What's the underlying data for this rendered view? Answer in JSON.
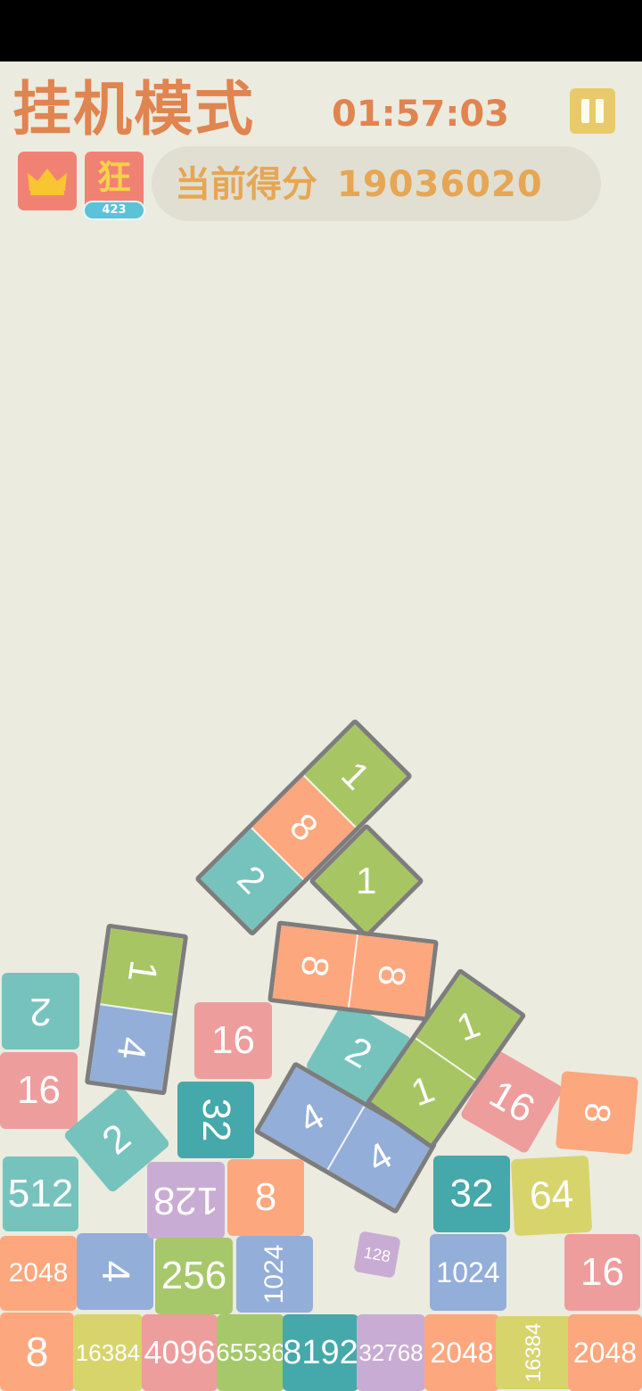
{
  "header": {
    "title": "挂机模式",
    "timer": "01:57:03",
    "frenzy_label": "狂",
    "frenzy_count": "423",
    "score_label": "当前得分",
    "score_value": "19036020"
  },
  "colors": {
    "title": "#e08450",
    "score_text": "#e6a653",
    "tile_2": "#76c3bd",
    "tile_4": "#93aed8",
    "tile_8": "#fda77e",
    "tile_16": "#ee9d9d",
    "tile_32": "#45a8aa",
    "tile_64": "#d7d46c",
    "tile_128": "#c9acd4",
    "tile_256": "#a6c86a",
    "tile_1": "#a8c563"
  },
  "tiles": [
    {
      "label": "2",
      "color": "#76c3bd"
    },
    {
      "label": "16",
      "color": "#ee9d9d"
    },
    {
      "label": "512",
      "color": "#76c3bd"
    },
    {
      "label": "2048",
      "color": "#fda77e"
    },
    {
      "label": "8",
      "color": "#fda77e"
    },
    {
      "label": "2",
      "color": "#76c3bd"
    },
    {
      "label": "4",
      "color": "#93aed8"
    },
    {
      "label": "16384",
      "color": "#d7d46c"
    },
    {
      "label": "128",
      "color": "#c9acd4"
    },
    {
      "label": "256",
      "color": "#a6c86a"
    },
    {
      "label": "4096",
      "color": "#ee9d9d"
    },
    {
      "label": "16",
      "color": "#ee9d9d"
    },
    {
      "label": "32",
      "color": "#45a8aa"
    },
    {
      "label": "8",
      "color": "#fda77e"
    },
    {
      "label": "1024",
      "color": "#93aed8"
    },
    {
      "label": "65536",
      "color": "#a6c86a"
    },
    {
      "label": "8192",
      "color": "#45a8aa"
    },
    {
      "label": "128",
      "color": "#c9acd4"
    },
    {
      "label": "32768",
      "color": "#c9acd4"
    },
    {
      "label": "32",
      "color": "#45a8aa"
    },
    {
      "label": "1024",
      "color": "#93aed8"
    },
    {
      "label": "2048",
      "color": "#fda77e"
    },
    {
      "label": "64",
      "color": "#d7d46c"
    },
    {
      "label": "16384",
      "color": "#d7d46c"
    },
    {
      "label": "16",
      "color": "#ee9d9d"
    },
    {
      "label": "8",
      "color": "#fda77e"
    },
    {
      "label": "16",
      "color": "#ee9d9d"
    },
    {
      "label": "2048",
      "color": "#fda77e"
    },
    {
      "label": "16",
      "color": "#ee9d9d"
    },
    {
      "label": "2",
      "color": "#76c3bd"
    }
  ],
  "blocks": [
    {
      "cells": [
        {
          "label": "1",
          "color": "#a8c563"
        },
        {
          "label": "4",
          "color": "#93aed8"
        }
      ]
    },
    {
      "cells": [
        {
          "label": "2",
          "color": "#76c3bd"
        },
        {
          "label": "8",
          "color": "#fda77e"
        },
        {
          "label": "1",
          "color": "#a8c563"
        }
      ]
    },
    {
      "cells": [
        {
          "label": "1",
          "color": "#a8c563"
        }
      ]
    },
    {
      "cells": [
        {
          "label": "8",
          "color": "#fda77e"
        },
        {
          "label": "8",
          "color": "#fda77e"
        }
      ]
    },
    {
      "cells": [
        {
          "label": "4",
          "color": "#93aed8"
        },
        {
          "label": "4",
          "color": "#93aed8"
        }
      ]
    },
    {
      "cells": [
        {
          "label": "1",
          "color": "#a8c563"
        },
        {
          "label": "1",
          "color": "#a8c563"
        }
      ]
    }
  ]
}
